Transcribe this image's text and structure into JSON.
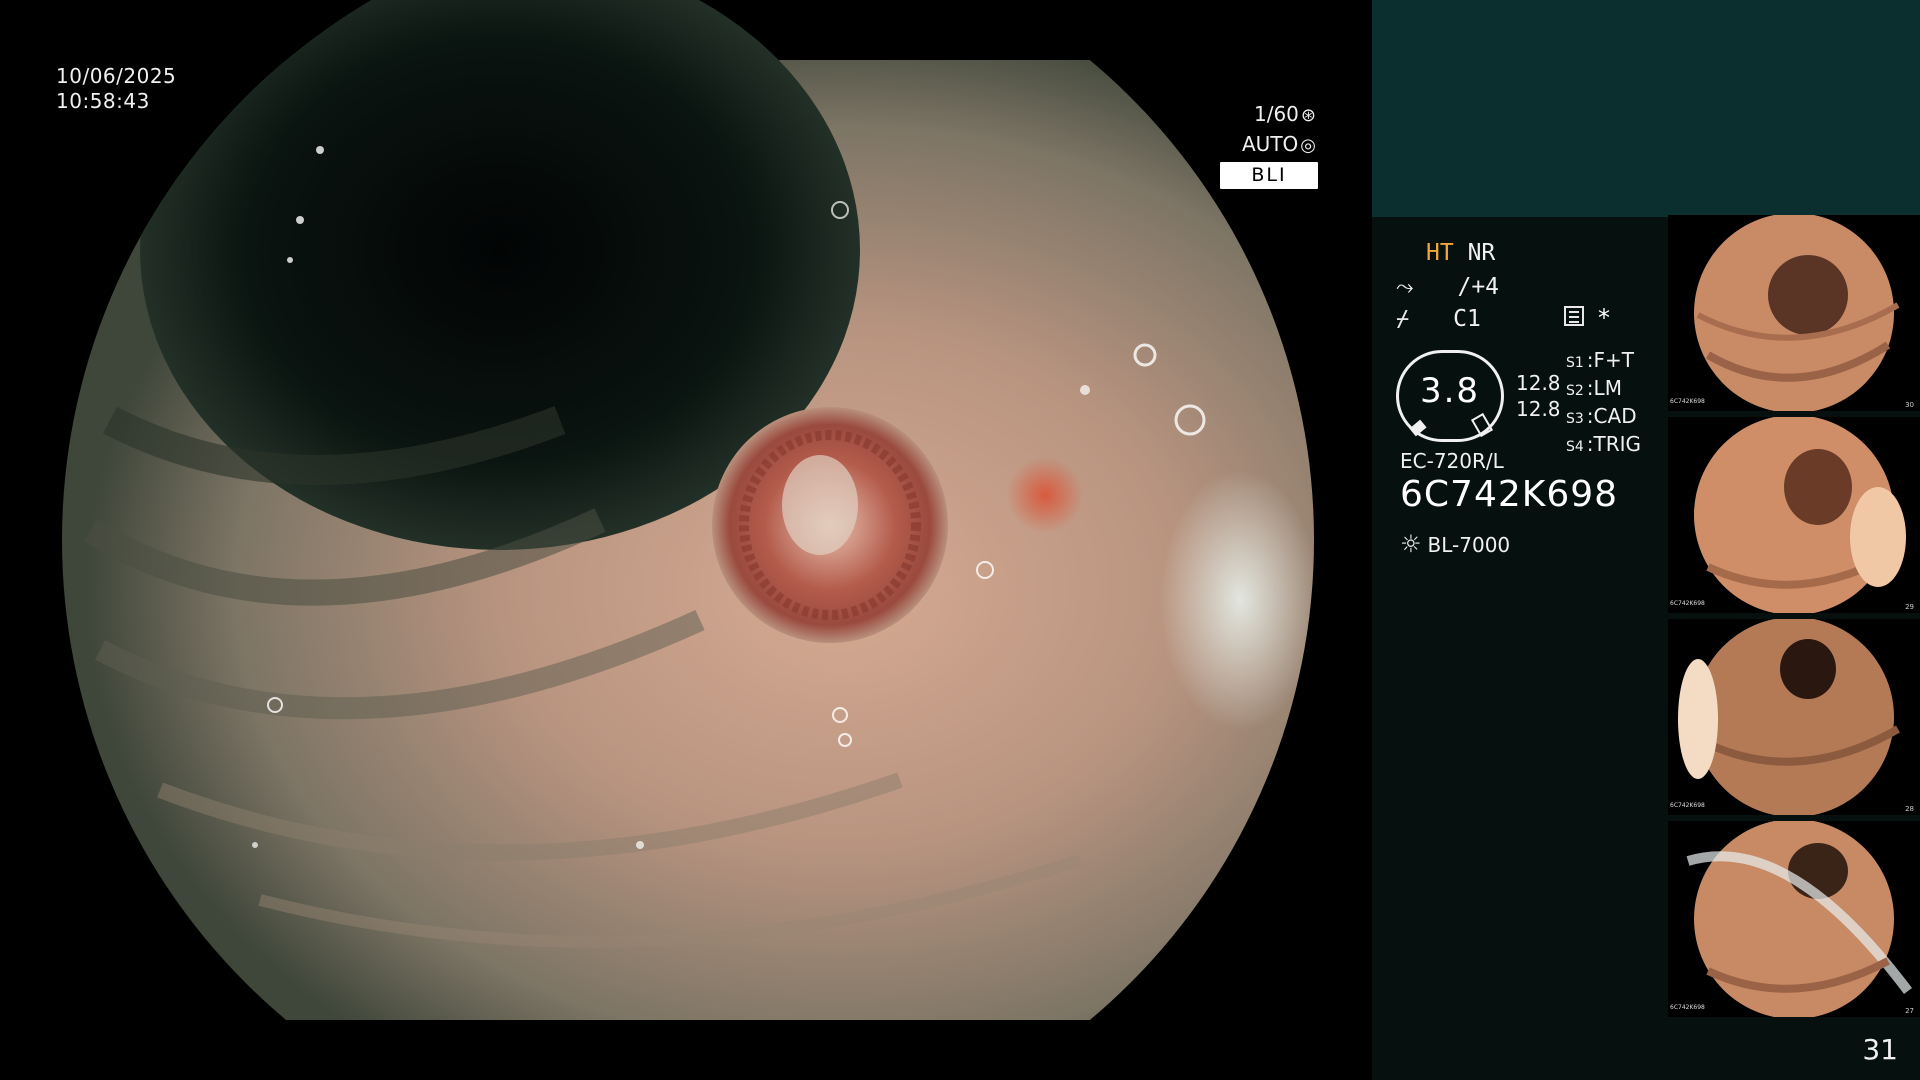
{
  "colors": {
    "panel_bg": "#06100f",
    "teal_box": "#0b2e2f",
    "ht_accent": "#f0a838",
    "bli_badge_bg": "#ffffff"
  },
  "endoscope": {
    "date": "10/06/2025",
    "time": "10:58:43",
    "shutter": "1/60",
    "shutter_icon": "shutter-icon",
    "iris": "AUTO",
    "iris_icon": "iris-icon",
    "mode": "BLI"
  },
  "panel": {
    "ht_label": "HT",
    "nr_label": "NR",
    "enhance_icon": "enhance-icon",
    "enhance_value": "/+4",
    "color_icon": "color-icon",
    "color_value": "C1",
    "menu_icon": "menu-icon",
    "star": "*",
    "dial_value": "3.8",
    "dial_num_1": "12.8",
    "dial_num_2": "12.8",
    "s_keys": [
      "S1",
      "S2",
      "S3",
      "S4"
    ],
    "s_values": [
      "F+T",
      "LM",
      "CAD",
      "TRIG"
    ],
    "scope_model": "EC-720R/L",
    "scope_serial": "6C742K698",
    "light_icon": "light-source-icon",
    "light_source": "BL-7000",
    "page_number": "31"
  },
  "thumbnails": [
    {
      "id": "6C742K698",
      "number": "30"
    },
    {
      "id": "6C742K698",
      "number": "29"
    },
    {
      "id": "6C742K698",
      "number": "28"
    },
    {
      "id": "6C742K698",
      "number": "27"
    }
  ]
}
